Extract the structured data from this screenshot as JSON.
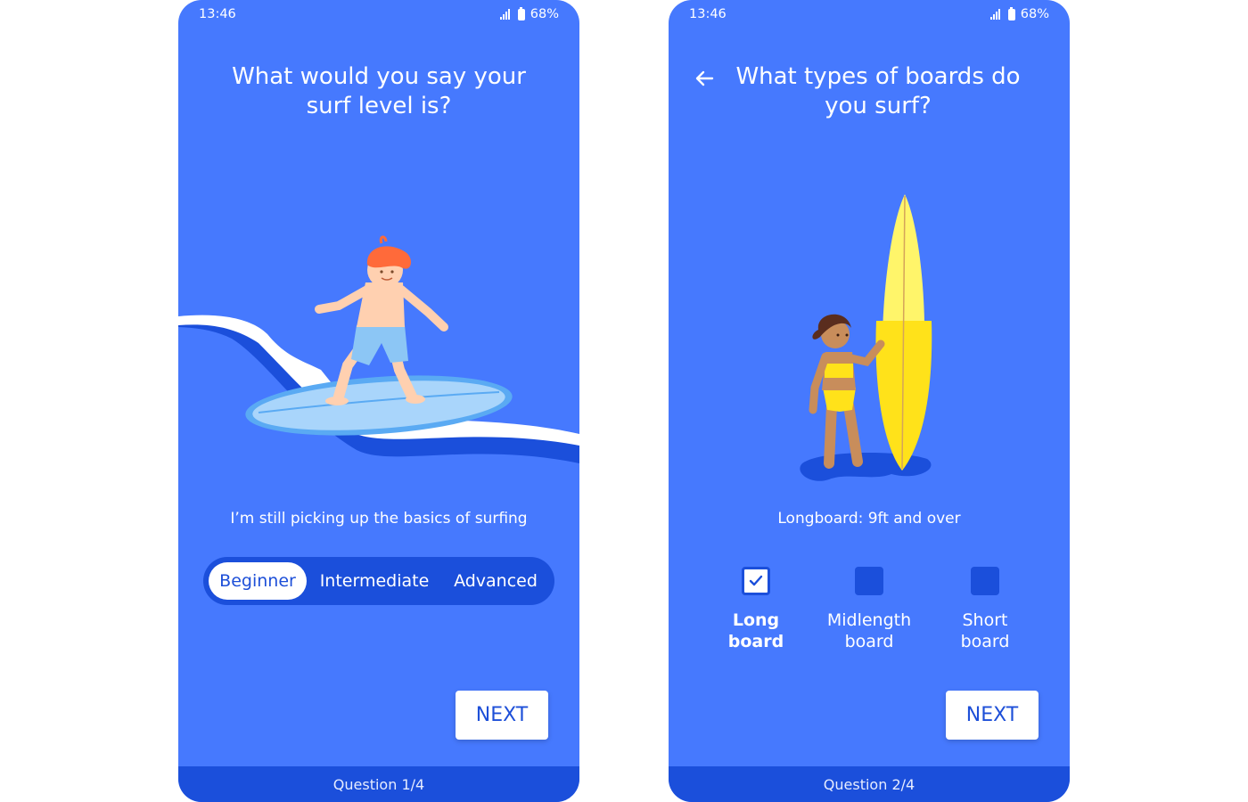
{
  "screens": [
    {
      "status": {
        "time": "13:46",
        "battery": "68%"
      },
      "title": "What would you say your surf level is?",
      "description": "I’m still picking up the basics of surfing",
      "levels": [
        {
          "label": "Beginner",
          "selected": true
        },
        {
          "label": "Intermediate",
          "selected": false
        },
        {
          "label": "Advanced",
          "selected": false
        }
      ],
      "next_label": "NEXT",
      "footer": "Question 1/4"
    },
    {
      "status": {
        "time": "13:46",
        "battery": "68%"
      },
      "title": "What types of boards do you surf?",
      "description": "Longboard: 9ft and over",
      "boards": [
        {
          "label": "Long\nboard",
          "checked": true
        },
        {
          "label": "Midlength\nboard",
          "checked": false
        },
        {
          "label": "Short\nboard",
          "checked": false
        }
      ],
      "next_label": "NEXT",
      "footer": "Question 2/4"
    }
  ],
  "colors": {
    "background": "#4679fe",
    "dark": "#1b4fdb",
    "accent": "#1d4fd8",
    "board_yellow": "#ffe21a"
  },
  "icons": [
    "signal-icon",
    "battery-icon",
    "back-arrow-icon",
    "checkmark-icon"
  ]
}
